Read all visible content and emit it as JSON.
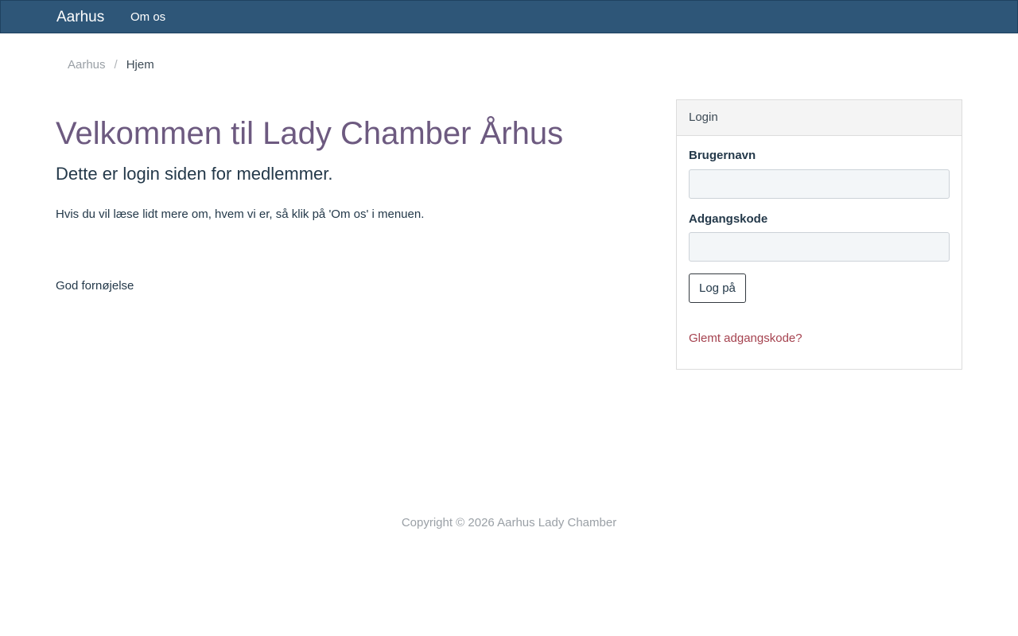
{
  "navbar": {
    "brand": "Aarhus",
    "links": [
      "Om os"
    ]
  },
  "breadcrumb": {
    "items": [
      "Aarhus",
      "Hjem"
    ],
    "separator": "/"
  },
  "main": {
    "title": "Velkommen til Lady Chamber Århus",
    "subtitle": "Dette er login siden for medlemmer.",
    "paragraphs": [
      "Hvis du vil læse lidt mere om, hvem vi er, så klik på 'Om os' i menuen.",
      "God fornøjelse"
    ]
  },
  "login": {
    "heading": "Login",
    "username_label": "Brugernavn",
    "username_value": "",
    "password_label": "Adgangskode",
    "password_value": "",
    "submit_label": "Log på",
    "forgot_label": "Glemt adgangskode?"
  },
  "footer": {
    "copyright": "Copyright © 2026 Aarhus Lady Chamber"
  },
  "colors": {
    "navbar": "#2e5678",
    "title": "#6d5a80",
    "link_accent": "#a5424f"
  }
}
